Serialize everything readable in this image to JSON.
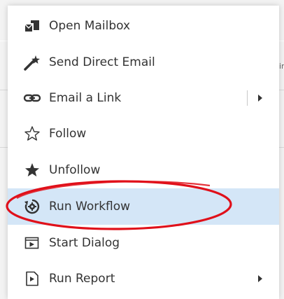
{
  "menu": {
    "items": [
      {
        "label": "Open Mailbox",
        "icon": "mailbox-icon",
        "submenu": false
      },
      {
        "label": "Send Direct Email",
        "icon": "magic-wand-icon",
        "submenu": false
      },
      {
        "label": "Email a Link",
        "icon": "link-icon",
        "submenu": true
      },
      {
        "label": "Follow",
        "icon": "star-outline-icon",
        "submenu": false
      },
      {
        "label": "Unfollow",
        "icon": "star-filled-icon",
        "submenu": false
      },
      {
        "label": "Run Workflow",
        "icon": "workflow-icon",
        "submenu": false,
        "highlighted": true,
        "annotated": true
      },
      {
        "label": "Start Dialog",
        "icon": "dialog-icon",
        "submenu": false
      },
      {
        "label": "Run Report",
        "icon": "report-icon",
        "submenu": true
      }
    ]
  },
  "background": {
    "fragment": "in"
  },
  "colors": {
    "highlight": "#d4e6f7",
    "annotation": "#e0101a",
    "text": "#333333"
  }
}
